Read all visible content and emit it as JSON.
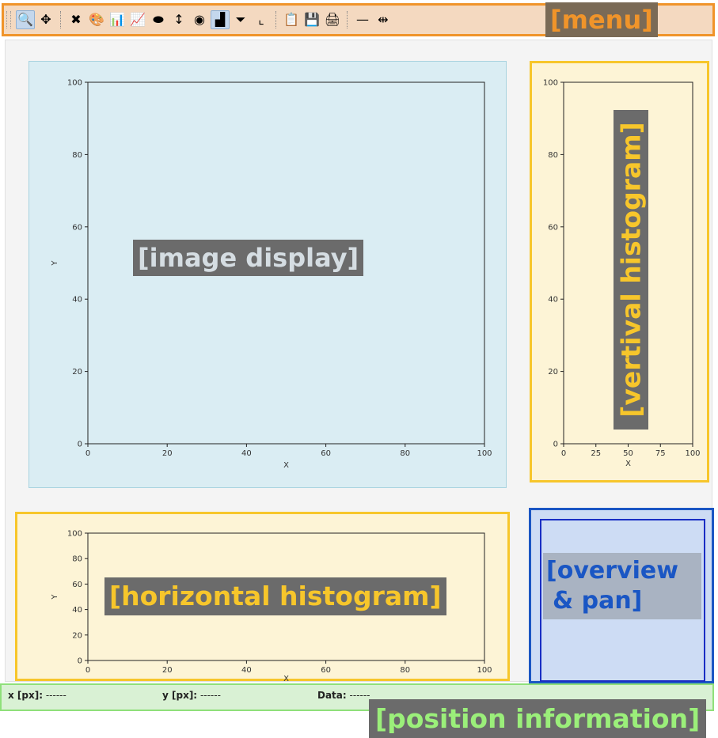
{
  "menu": {
    "label": "[menu]",
    "tools": [
      {
        "name": "zoom-icon",
        "glyph": "🔍",
        "active": true
      },
      {
        "name": "pan-icon",
        "glyph": "✥"
      },
      {
        "name": "reset-zoom-icon",
        "glyph": "✖"
      },
      {
        "name": "colormap-icon",
        "glyph": "🎨"
      },
      {
        "name": "auto-scale-icon",
        "glyph": "📊"
      },
      {
        "name": "scale-sigma-icon",
        "glyph": "📈"
      },
      {
        "name": "aspect-ratio-icon",
        "glyph": "⬬"
      },
      {
        "name": "y-axis-icon",
        "glyph": "↕"
      },
      {
        "name": "mask-icon",
        "glyph": "◉"
      },
      {
        "name": "profile-icon",
        "glyph": "▟",
        "active": true
      },
      {
        "name": "filter-icon",
        "glyph": "⏷"
      },
      {
        "name": "axes-icon",
        "glyph": "⌞"
      },
      {
        "name": "copy-icon",
        "glyph": "📋"
      },
      {
        "name": "save-icon",
        "glyph": "💾"
      },
      {
        "name": "print-icon",
        "glyph": "🖨"
      },
      {
        "name": "line-style-icon",
        "glyph": "—"
      },
      {
        "name": "marker-icon",
        "glyph": "⇹"
      }
    ]
  },
  "image_display": {
    "label": "[image display]",
    "xlabel": "X",
    "ylabel": "Y",
    "x_ticks": [
      "0",
      "20",
      "40",
      "60",
      "80",
      "100"
    ],
    "y_ticks": [
      "0",
      "20",
      "40",
      "60",
      "80",
      "100"
    ]
  },
  "vertical_histogram": {
    "label": "[vertival histogram]",
    "xlabel": "X",
    "x_ticks": [
      "0",
      "25",
      "50",
      "75",
      "100"
    ],
    "y_ticks": [
      "0",
      "20",
      "40",
      "60",
      "80",
      "100"
    ]
  },
  "horizontal_histogram": {
    "label": "[horizontal histogram]",
    "xlabel": "X",
    "ylabel": "Y",
    "x_ticks": [
      "0",
      "20",
      "40",
      "60",
      "80",
      "100"
    ],
    "y_ticks": [
      "0",
      "20",
      "40",
      "60",
      "80",
      "100"
    ]
  },
  "overview": {
    "label_line1": "[overview",
    "label_line2": "& pan]"
  },
  "position_info": {
    "x_label": "x [px]:",
    "x_value": "------",
    "y_label": "y [px]:",
    "y_value": "------",
    "data_label": "Data:",
    "data_value": "------",
    "label": "[position information]"
  },
  "colors": {
    "menu_border": "#f0942a",
    "histogram_border": "#f7c62b",
    "overview_border": "#1a56c4",
    "position_border": "#8fe07a",
    "image_bg": "#daedf3"
  }
}
